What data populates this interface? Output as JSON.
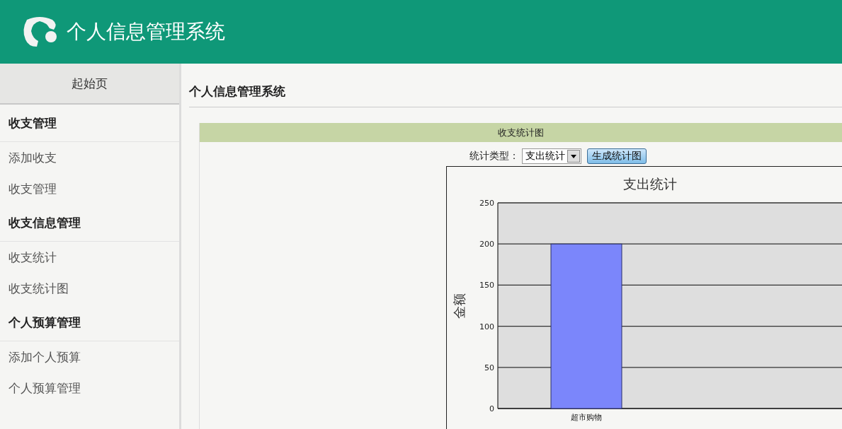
{
  "header": {
    "title": "个人信息管理系统"
  },
  "sidebar": {
    "items": [
      {
        "kind": "home",
        "label": "起始页"
      },
      {
        "kind": "group",
        "label": "收支管理"
      },
      {
        "kind": "link",
        "label": "添加收支"
      },
      {
        "kind": "link",
        "label": "收支管理"
      },
      {
        "kind": "group",
        "label": "收支信息管理"
      },
      {
        "kind": "link",
        "label": "收支统计"
      },
      {
        "kind": "link",
        "label": "收支统计图"
      },
      {
        "kind": "group",
        "label": "个人预算管理"
      },
      {
        "kind": "link",
        "label": "添加个人预算"
      },
      {
        "kind": "link",
        "label": "个人预算管理"
      }
    ]
  },
  "page": {
    "title": "个人信息管理系统"
  },
  "panel": {
    "title": "收支统计图",
    "filter": {
      "label": "统计类型：",
      "value": "支出统计"
    },
    "button": "生成统计图",
    "chart_data": {
      "type": "bar",
      "title": "支出统计",
      "ylabel": "金额",
      "categories": [
        "超市购物"
      ],
      "series": [
        {
          "color": "#7b86fb",
          "values": [
            200
          ]
        }
      ],
      "grid": true,
      "ylim": [
        0,
        250
      ],
      "yticks": [
        0,
        50,
        100,
        150,
        200,
        250
      ]
    }
  }
}
